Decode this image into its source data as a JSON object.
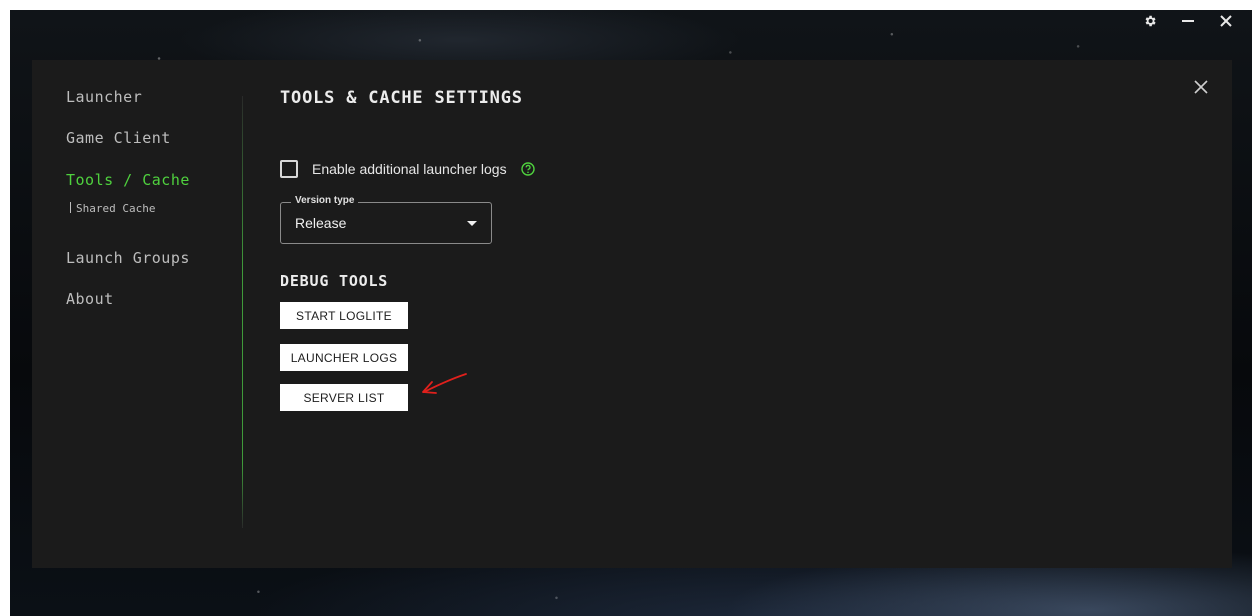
{
  "window_controls": {
    "settings_icon": "gear-icon",
    "minimize_icon": "minimize-icon",
    "close_icon": "close-icon"
  },
  "sidebar": {
    "items": [
      {
        "label": "Launcher"
      },
      {
        "label": "Game Client"
      },
      {
        "label": "Tools / Cache",
        "active": true
      },
      {
        "label": "Shared Cache",
        "sub": true
      },
      {
        "label": "Launch Groups"
      },
      {
        "label": "About"
      }
    ]
  },
  "main": {
    "title": "TOOLS & CACHE SETTINGS",
    "logs_checkbox": {
      "label": "Enable additional launcher logs",
      "checked": false,
      "help_icon": "help-circle-icon"
    },
    "version_type": {
      "label": "Version type",
      "value": "Release"
    },
    "debug_tools": {
      "heading": "DEBUG TOOLS",
      "buttons": [
        {
          "label": "START LOGLITE"
        },
        {
          "label": "LAUNCHER LOGS"
        },
        {
          "label": "SERVER LIST"
        }
      ]
    }
  },
  "colors": {
    "accent": "#4fd13e",
    "panel_bg": "#1b1b1b",
    "annotation": "#e0201c"
  }
}
